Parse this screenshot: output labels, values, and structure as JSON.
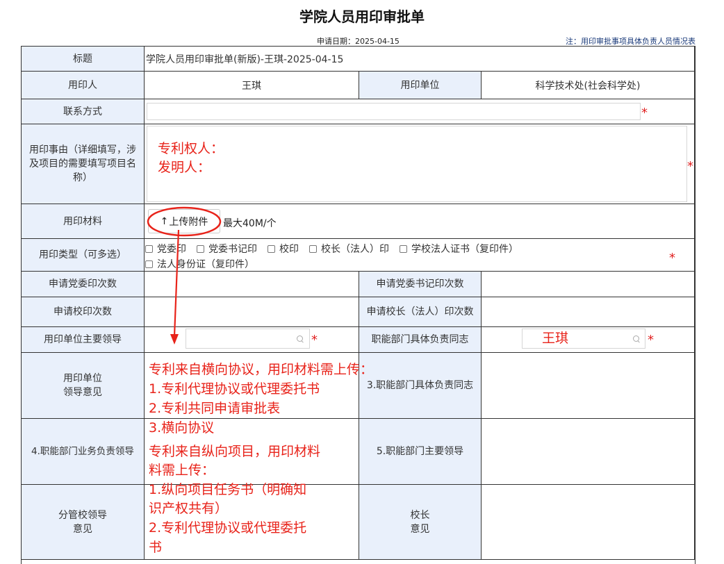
{
  "page": {
    "title": "学院人员用印审批单",
    "apply_date": "申请日期：2025-04-15",
    "note": "注：用印审批事项具体负责人员情况表"
  },
  "form": {
    "title_label": "标题",
    "title_value": "学院人员用印审批单(新版)-王琪-2025-04-15",
    "applicant_label": "用印人",
    "applicant_value": "王琪",
    "unit_label": "用印单位",
    "unit_value": "科学技术处(社会科学处)",
    "contact_label": "联系方式",
    "contact_value": "",
    "reason_label": "用印事由（详细填写，涉及项目的需要填写项目名称）",
    "reason_lines": [
      "专利权人：",
      "发明人："
    ],
    "material_label": "用印材料",
    "upload_label": "上传附件",
    "upload_icon": "↑",
    "upload_limit": "最大40M/个",
    "seal_type_label": "用印类型（可多选）",
    "seal_types": [
      "党委印",
      "党委书记印",
      "校印",
      "校长（法人）印",
      "学校法人证书（复印件）",
      "法人身份证（复印件）"
    ],
    "party_seal_count_label": "申请党委印次数",
    "party_sec_seal_count_label": "申请党委书记印次数",
    "school_seal_count_label": "申请校印次数",
    "president_seal_count_label": "申请校长（法人）印次数",
    "unit_leader_label": "用印单位主要领导",
    "dept_owner_label": "职能部门具体负责同志",
    "dept_owner_value": "王琪",
    "unit_leader_opinion_label": "用印单位\n领导意见",
    "step3_label": "3.职能部门具体负责同志",
    "step4_label": "4.职能部门业务负责领导",
    "step5_label": "5.职能部门主要领导",
    "vp_opinion_label": "分管校领导\n意见",
    "president_opinion_label": "校长\n意见",
    "required_mark": "*"
  },
  "annotation": {
    "lines": [
      "专利来自横向协议，用印材料需上传：",
      "1.专利代理协议或代理委托书",
      "2.专利共同申请审批表",
      "3.横向协议",
      "专利来自纵向项目，用印材料",
      "料需上传：",
      "1.纵向项目任务书（明确知",
      "识产权共有）",
      "2.专利代理协议或代理委托",
      "书"
    ],
    "color": "#e8231a"
  },
  "colors": {
    "label_bg": "#e9f0fb",
    "border": "#333333",
    "required": "#e02020"
  }
}
